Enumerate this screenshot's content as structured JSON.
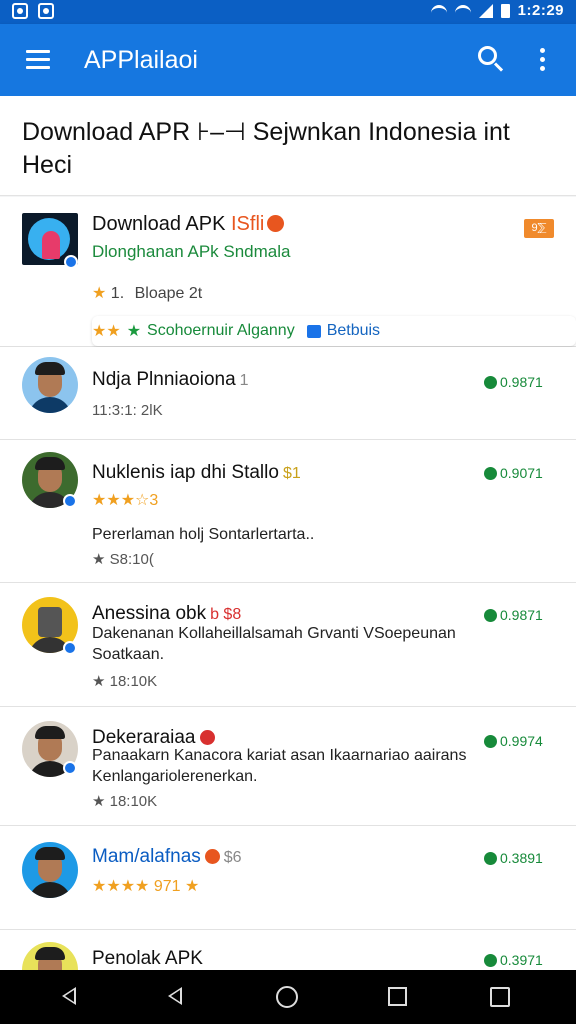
{
  "status_bar": {
    "time": "1:2:29",
    "icons": [
      "notification-icon",
      "gallery-icon",
      "wifi-icon",
      "wifi-icon",
      "signal-icon",
      "battery-icon"
    ]
  },
  "app_bar": {
    "title": "APPlailaoi",
    "icons": [
      "menu-icon",
      "search-icon",
      "more-vert-icon"
    ]
  },
  "page": {
    "title": "Download APR ⊦–⊣ Sejwnkan Indonesia int Heci"
  },
  "featured": {
    "title": "Download APK",
    "title_suffix": "ISfli",
    "subtitle": "Dlonghanan APk Sndmala",
    "badge": "9⅀",
    "rating_star": "★",
    "rating": "1.",
    "rating_text": "Bloape 2t",
    "stars": "★★",
    "tag_star": "★",
    "tag_green": "Scohoernuir Alganny",
    "tag_blue": "Betbuis"
  },
  "rows": [
    {
      "title": "Ndja Plnniaoiona",
      "title_extra": "1",
      "meta": "11:3:1: 2lK",
      "price": "0.9871"
    },
    {
      "title": "Nuklenis iap dhi Stallo",
      "title_extra": "$1",
      "stars": "★★★☆3",
      "desc": "Pererlaman  holj  Sontarlertarta..",
      "meta": "★ S8:10(",
      "price": "0.9071"
    },
    {
      "title": "Anessina obk",
      "title_extra": "b $8",
      "desc": "Dakenanan Kollaheillalsamah Grvanti VSoepeunan Soatkaan.",
      "meta": "★ 18:10K",
      "price": "0.9871"
    },
    {
      "title": "Dekeraraiaa",
      "desc": "Panaakarn Kanacora kariat asan Ikaarnariao aairans Kenlangariolerenerkan.",
      "meta": "★ 18:10K",
      "price": "0.9974"
    },
    {
      "title": "Mam/alafnas",
      "title_extra": "$6",
      "stars": "★★★★ 971 ★",
      "price": "0.3891"
    },
    {
      "title": "Penolak APK",
      "price": "0.3971"
    }
  ],
  "nav_bar": {
    "icons": [
      "back-icon",
      "back-icon",
      "home-icon",
      "recents-icon",
      "split-screen-icon"
    ]
  },
  "colors": {
    "primary": "#1677e0",
    "status_bar": "#0b5fc4",
    "green": "#178a3a",
    "star": "#f0a020",
    "badge": "#f08a2c"
  }
}
